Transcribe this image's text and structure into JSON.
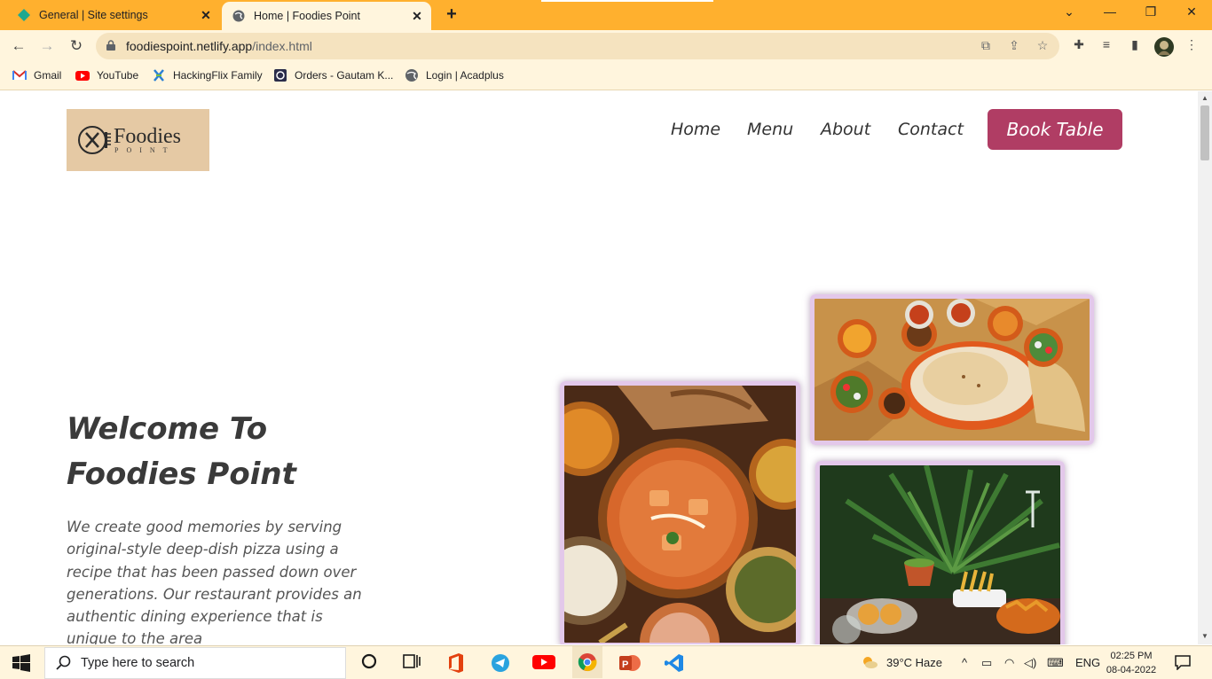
{
  "browser": {
    "tabs": [
      {
        "title": "General | Site settings",
        "active": false,
        "icon": "diamond-icon"
      },
      {
        "title": "Home | Foodies Point",
        "active": true,
        "icon": "globe-icon"
      }
    ],
    "new_tab": "+",
    "window_controls": [
      "chevron-down-icon",
      "minimize-icon",
      "restore-icon",
      "close-icon"
    ],
    "url_host": "foodiespoint.netlify.app",
    "url_path": "/index.html",
    "bookmarks": [
      {
        "label": "Gmail",
        "icon": "gmail-icon"
      },
      {
        "label": "YouTube",
        "icon": "youtube-icon"
      },
      {
        "label": "HackingFlix Family",
        "icon": "hackingflix-icon"
      },
      {
        "label": "Orders - Gautam K...",
        "icon": "orders-icon"
      },
      {
        "label": "Login | Acadplus",
        "icon": "globe-icon"
      }
    ]
  },
  "site": {
    "logo": {
      "name": "Foodies",
      "sub": "POINT"
    },
    "nav": [
      "Home",
      "Menu",
      "About",
      "Contact"
    ],
    "book_button": "Book Table",
    "hero": {
      "title_line1": "Welcome To",
      "title_line2": "Foodies Point",
      "text": "We create good memories by serving original-style deep-dish pizza using a recipe that has been passed down over generations. Our restaurant provides an authentic dining experience that is unique to the area"
    },
    "photos": [
      "indian-thali-photo",
      "curry-dishes-photo",
      "restaurant-table-photo"
    ]
  },
  "taskbar": {
    "search_placeholder": "Type here to search",
    "weather": "39°C  Haze",
    "language": "ENG",
    "time": "02:25 PM",
    "date": "08-04-2022"
  },
  "colors": {
    "tabbar": "#ffb02e",
    "toolbar": "#fff5dd",
    "accent": "#b03d64",
    "logo_bg": "#e5c9a4"
  }
}
